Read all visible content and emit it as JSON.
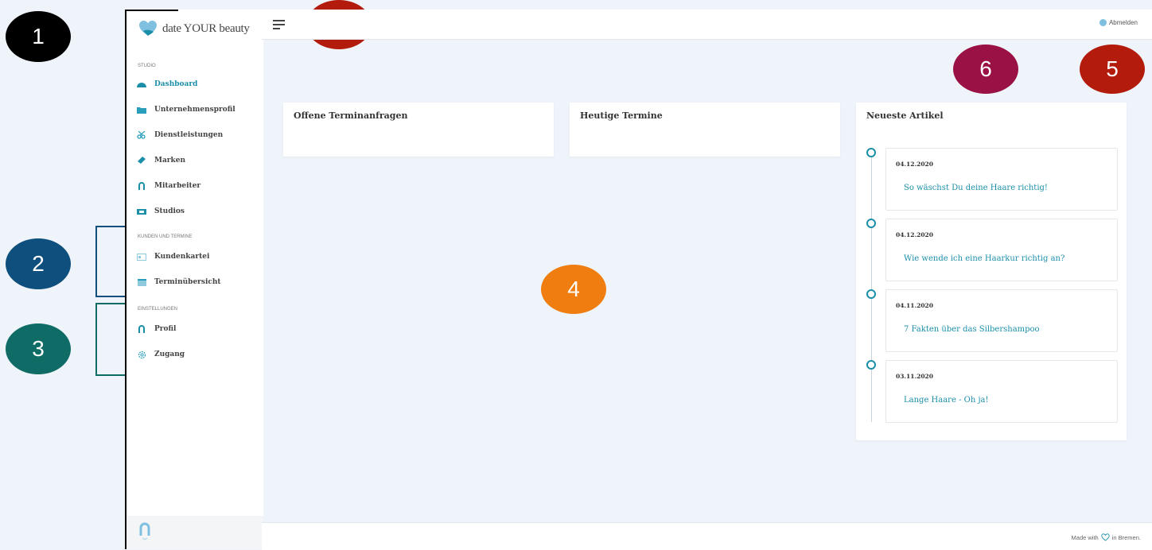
{
  "app": {
    "brand": "date YOUR beauty"
  },
  "sidebar": {
    "sections": [
      {
        "label": "STUDIO"
      },
      {
        "label": "KUNDEN UND TERMINE"
      },
      {
        "label": "EINSTELLUNGEN"
      }
    ],
    "items": [
      {
        "label": "Dashboard",
        "icon": "dashboard-icon",
        "active": true
      },
      {
        "label": "Unternehmensprofil",
        "icon": "folder-icon"
      },
      {
        "label": "Dienstleistungen",
        "icon": "scissors-icon"
      },
      {
        "label": "Marken",
        "icon": "tag-icon"
      },
      {
        "label": "Mitarbeiter",
        "icon": "employee-icon"
      },
      {
        "label": "Studios",
        "icon": "store-icon"
      },
      {
        "label": "Kundenkartei",
        "icon": "card-icon"
      },
      {
        "label": "Terminübersicht",
        "icon": "calendar-icon"
      },
      {
        "label": "Profil",
        "icon": "user-icon"
      },
      {
        "label": "Zugang",
        "icon": "gear-icon"
      }
    ]
  },
  "topbar": {
    "logout_label": "Abmelden"
  },
  "cards": {
    "open_requests": {
      "title": "Offene Terminanfragen"
    },
    "today": {
      "title": "Heutige Termine"
    },
    "articles": {
      "title": "Neueste Artikel",
      "items": [
        {
          "date": "04.12.2020",
          "title": "So wäschst Du deine Haare richtig!"
        },
        {
          "date": "04.12.2020",
          "title": "Wie wende ich eine Haarkur richtig an?"
        },
        {
          "date": "04.11.2020",
          "title": "7 Fakten über das Silbershampoo"
        },
        {
          "date": "03.11.2020",
          "title": "Lange Haare - Oh ja!"
        }
      ]
    }
  },
  "footer": {
    "prefix": "Made with",
    "suffix": "in Bremen."
  },
  "annotations": [
    {
      "label": "1",
      "color": "#000000"
    },
    {
      "label": "2",
      "color": "#0f4f7d"
    },
    {
      "label": "3",
      "color": "#0f6b66"
    },
    {
      "label": "4",
      "color": "#ef7d10"
    },
    {
      "label": "5",
      "color": "#b31b0c"
    },
    {
      "label": "6",
      "color": "#9a1245"
    },
    {
      "label": "5",
      "color": "#b31b0c"
    }
  ],
  "colors": {
    "accent": "#1b8fa8",
    "background": "#eef4fa"
  }
}
